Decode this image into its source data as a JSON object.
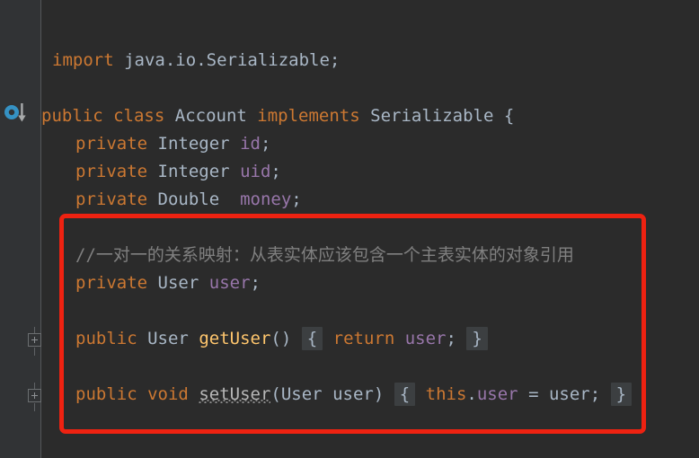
{
  "editor": {
    "background_color": "#2b2b2b",
    "gutter_color": "#313335",
    "annotation_color": "#ee2211",
    "gutter_icons": {
      "implemented_marker": "implements-arrow-icon",
      "fold_marker_1": "fold-expand-icon",
      "fold_marker_2": "fold-expand-icon"
    },
    "lines": [
      {
        "id": "import",
        "tokens": [
          {
            "text": "import",
            "kind": "kw"
          },
          {
            "text": " java",
            "kind": "plain"
          },
          {
            "text": ".",
            "kind": "punc"
          },
          {
            "text": "io",
            "kind": "plain"
          },
          {
            "text": ".",
            "kind": "punc"
          },
          {
            "text": "Serializable",
            "kind": "type"
          },
          {
            "text": ";",
            "kind": "punc"
          }
        ]
      },
      {
        "id": "class-decl",
        "tokens": [
          {
            "text": "public",
            "kind": "kw"
          },
          {
            "text": " ",
            "kind": "plain"
          },
          {
            "text": "class",
            "kind": "kw"
          },
          {
            "text": " ",
            "kind": "plain"
          },
          {
            "text": "Account",
            "kind": "type"
          },
          {
            "text": " ",
            "kind": "plain"
          },
          {
            "text": "implements",
            "kind": "kw"
          },
          {
            "text": " ",
            "kind": "plain"
          },
          {
            "text": "Serializable",
            "kind": "type"
          },
          {
            "text": " {",
            "kind": "punc"
          }
        ]
      },
      {
        "id": "field-id",
        "tokens": [
          {
            "text": "private",
            "kind": "kw"
          },
          {
            "text": " ",
            "kind": "plain"
          },
          {
            "text": "Integer",
            "kind": "type"
          },
          {
            "text": " ",
            "kind": "plain"
          },
          {
            "text": "id",
            "kind": "field"
          },
          {
            "text": ";",
            "kind": "punc"
          }
        ]
      },
      {
        "id": "field-uid",
        "tokens": [
          {
            "text": "private",
            "kind": "kw"
          },
          {
            "text": " ",
            "kind": "plain"
          },
          {
            "text": "Integer",
            "kind": "type"
          },
          {
            "text": " ",
            "kind": "plain"
          },
          {
            "text": "uid",
            "kind": "field"
          },
          {
            "text": ";",
            "kind": "punc"
          }
        ]
      },
      {
        "id": "field-money",
        "tokens": [
          {
            "text": "private",
            "kind": "kw"
          },
          {
            "text": " ",
            "kind": "plain"
          },
          {
            "text": "Double",
            "kind": "type"
          },
          {
            "text": "  ",
            "kind": "plain"
          },
          {
            "text": "money",
            "kind": "field"
          },
          {
            "text": ";",
            "kind": "punc"
          }
        ]
      },
      {
        "id": "comment",
        "tokens": [
          {
            "text": "//一对一的关系映射：从表实体应该包含一个主表实体的对象引用",
            "kind": "comment"
          }
        ]
      },
      {
        "id": "field-user",
        "tokens": [
          {
            "text": "private",
            "kind": "kw"
          },
          {
            "text": " ",
            "kind": "plain"
          },
          {
            "text": "User",
            "kind": "type"
          },
          {
            "text": " ",
            "kind": "plain"
          },
          {
            "text": "user",
            "kind": "field"
          },
          {
            "text": ";",
            "kind": "punc"
          }
        ]
      },
      {
        "id": "method-getuser",
        "tokens": [
          {
            "text": "public",
            "kind": "kw"
          },
          {
            "text": " ",
            "kind": "plain"
          },
          {
            "text": "User",
            "kind": "type"
          },
          {
            "text": " ",
            "kind": "plain"
          },
          {
            "text": "getUser",
            "kind": "method"
          },
          {
            "text": "()",
            "kind": "punc"
          },
          {
            "text": " ",
            "kind": "plain"
          },
          {
            "text": "{",
            "kind": "fold"
          },
          {
            "text": " ",
            "kind": "plain"
          },
          {
            "text": "return",
            "kind": "kw"
          },
          {
            "text": " ",
            "kind": "plain"
          },
          {
            "text": "user",
            "kind": "field"
          },
          {
            "text": ";",
            "kind": "punc"
          },
          {
            "text": " ",
            "kind": "plain"
          },
          {
            "text": "}",
            "kind": "fold"
          }
        ]
      },
      {
        "id": "method-setuser",
        "tokens": [
          {
            "text": "public",
            "kind": "kw"
          },
          {
            "text": " ",
            "kind": "plain"
          },
          {
            "text": "void",
            "kind": "kw"
          },
          {
            "text": " ",
            "kind": "plain"
          },
          {
            "text": "setUser",
            "kind": "wavy"
          },
          {
            "text": "(",
            "kind": "punc"
          },
          {
            "text": "User",
            "kind": "type"
          },
          {
            "text": " ",
            "kind": "plain"
          },
          {
            "text": "user",
            "kind": "plain"
          },
          {
            "text": ")",
            "kind": "punc"
          },
          {
            "text": " ",
            "kind": "plain"
          },
          {
            "text": "{",
            "kind": "fold"
          },
          {
            "text": " ",
            "kind": "plain"
          },
          {
            "text": "this",
            "kind": "kw"
          },
          {
            "text": ".",
            "kind": "punc"
          },
          {
            "text": "user",
            "kind": "field"
          },
          {
            "text": " = ",
            "kind": "punc"
          },
          {
            "text": "user",
            "kind": "plain"
          },
          {
            "text": ";",
            "kind": "punc"
          },
          {
            "text": " ",
            "kind": "plain"
          },
          {
            "text": "}",
            "kind": "fold"
          }
        ]
      }
    ]
  }
}
